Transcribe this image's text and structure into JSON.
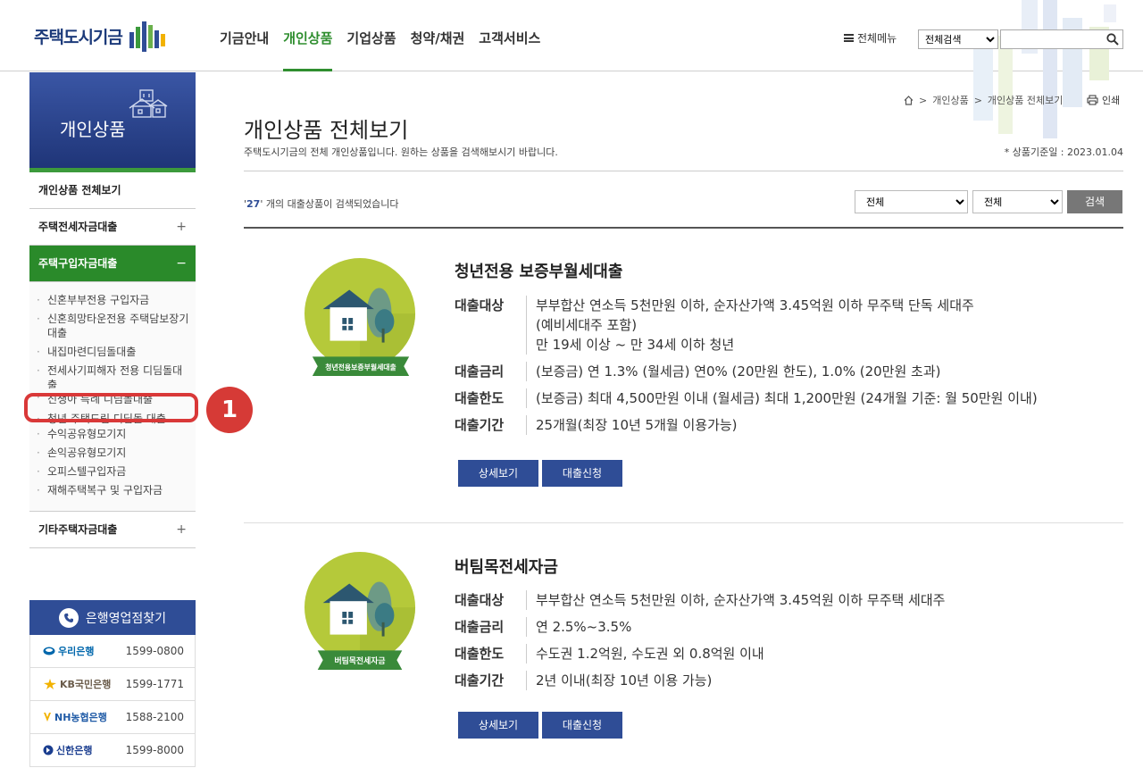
{
  "header": {
    "logo_text": "주택도시기금",
    "nav": [
      "기금안내",
      "개인상품",
      "기업상품",
      "청약/채권",
      "고객서비스"
    ],
    "active_nav": 1,
    "all_menu": "전체메뉴",
    "search_scope": "전체검색",
    "search_value": ""
  },
  "sidebar": {
    "banner_title": "개인상품",
    "menu_all": "개인상품 전체보기",
    "menu_jeonse": "주택전세자금대출",
    "menu_purchase": "주택구입자금대출",
    "sub_items": [
      "신혼부부전용 구입자금",
      "신혼희망타운전용 주택담보장기대출",
      "내집마련디딤돌대출",
      "전세사기피해자 전용 디딤돌대출",
      "신생아 특례 디딤돌대출",
      "청년 주택드림 디딤돌 대출",
      "수익공유형모기지",
      "손익공유형모기지",
      "오피스텔구입자금",
      "재해주택복구 및 구입자금"
    ],
    "menu_other": "기타주택자금대출",
    "plus": "+",
    "minus": "−",
    "annotation_number": "1"
  },
  "banks": {
    "title": "은행영업점찾기",
    "rows": [
      {
        "name": "우리은행",
        "phone": "1599-0800",
        "color": "#0067ac"
      },
      {
        "name": "KB국민은행",
        "phone": "1599-1771",
        "color": "#6b5c4b"
      },
      {
        "name": "NH농협은행",
        "phone": "1588-2100",
        "color": "#1f5aa6"
      },
      {
        "name": "신한은행",
        "phone": "1599-8000",
        "color": "#1a3d8f"
      }
    ]
  },
  "content": {
    "breadcrumb": [
      "개인상품",
      "개인상품 전체보기"
    ],
    "breadcrumb_sep": ">",
    "print": "인쇄",
    "title": "개인상품 전체보기",
    "desc": "주택도시기금의 전체 개인상품입니다. 원하는 상품을 검색해보시기 바랍니다.",
    "base_date": "* 상품기준일 : 2023.01.04",
    "count": "27",
    "count_prefix": "'",
    "count_suffix": "' 개의 대출상품이 검색되었습니다",
    "filter1": "전체",
    "filter2": "전체",
    "search_btn": "검색"
  },
  "products": [
    {
      "name": "청년전용 보증부월세대출",
      "badge": "청년전용보증부월세대출",
      "specs": [
        {
          "key": "대출대상",
          "value": "부부합산 연소득 5천만원 이하, 순자산가액 3.45억원 이하 무주택 단독 세대주\n(예비세대주 포함)\n만 19세 이상 ~ 만 34세 이하 청년"
        },
        {
          "key": "대출금리",
          "value": "(보증금) 연 1.3% (월세금) 연0% (20만원 한도),  1.0% (20만원 초과)"
        },
        {
          "key": "대출한도",
          "value": "(보증금) 최대 4,500만원 이내 (월세금) 최대 1,200만원 (24개월 기준: 월 50만원 이내)"
        },
        {
          "key": "대출기간",
          "value": "25개월(최장 10년 5개월 이용가능)"
        }
      ],
      "btn_detail": "상세보기",
      "btn_apply": "대출신청"
    },
    {
      "name": "버팀목전세자금",
      "badge": "버팀목전세자금",
      "specs": [
        {
          "key": "대출대상",
          "value": "부부합산 연소득 5천만원 이하, 순자산가액 3.45억원 이하 무주택 세대주"
        },
        {
          "key": "대출금리",
          "value": "연 2.5%~3.5%"
        },
        {
          "key": "대출한도",
          "value": "수도권 1.2억원, 수도권 외 0.8억원 이내"
        },
        {
          "key": "대출기간",
          "value": "2년 이내(최장 10년 이용 가능)"
        }
      ],
      "btn_detail": "상세보기",
      "btn_apply": "대출신청"
    }
  ],
  "colors": {
    "brand_blue": "#2f4d96",
    "brand_green": "#2f8e2f",
    "badge_lime": "#b5c93a",
    "highlight_red": "#d93838"
  }
}
